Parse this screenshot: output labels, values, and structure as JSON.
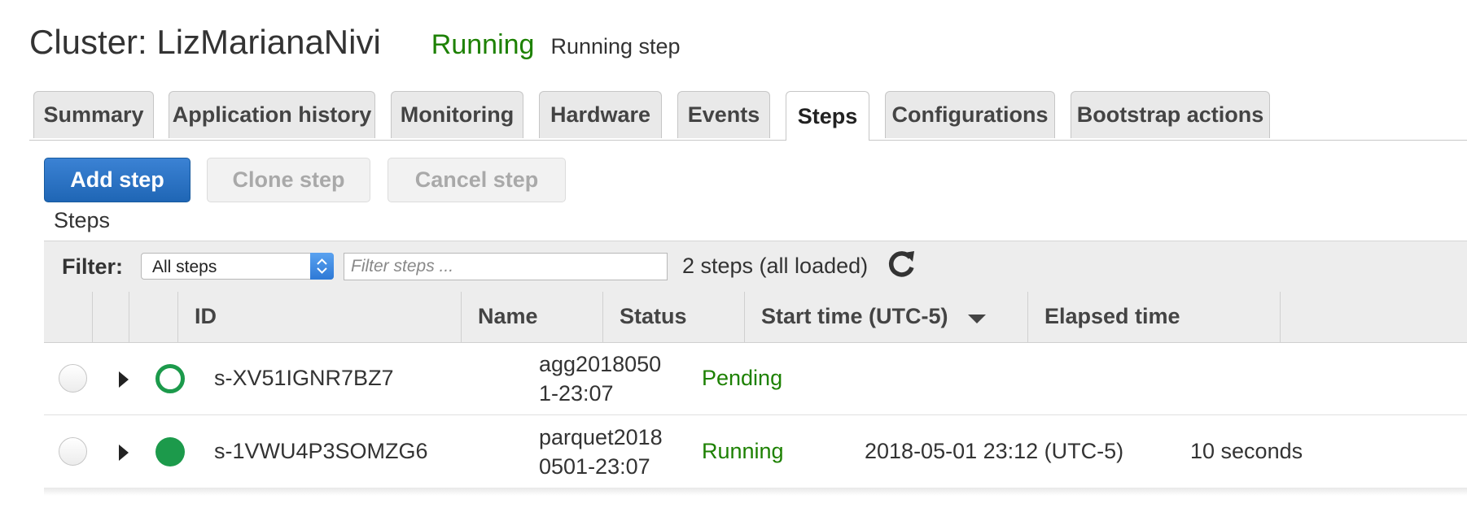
{
  "cluster": {
    "title": "Cluster: LizMarianaNivi",
    "state": "Running",
    "state_detail": "Running step"
  },
  "tabs": [
    {
      "label": "Summary"
    },
    {
      "label": "Application history"
    },
    {
      "label": "Monitoring"
    },
    {
      "label": "Hardware"
    },
    {
      "label": "Events"
    },
    {
      "label": "Steps",
      "active": true
    },
    {
      "label": "Configurations"
    },
    {
      "label": "Bootstrap actions"
    }
  ],
  "toolbar": {
    "add_step": "Add step",
    "clone_step": "Clone step",
    "cancel_step": "Cancel step"
  },
  "section_title": "Steps",
  "filter": {
    "label": "Filter:",
    "select_value": "All steps",
    "input_placeholder": "Filter steps ...",
    "count_text": "2 steps (all loaded)"
  },
  "table": {
    "columns": [
      "ID",
      "Name",
      "Status",
      "Start time (UTC-5)",
      "Elapsed time"
    ],
    "sorted_column": "Start time (UTC-5)",
    "rows": [
      {
        "id": "s-XV51IGNR7BZ7",
        "name_line1": "agg2018050",
        "name_line2": "1-23:07",
        "status": "Pending",
        "start_time": "",
        "elapsed": ""
      },
      {
        "id": "s-1VWU4P3SOMZG6",
        "name_line1": "parquet2018",
        "name_line2": "0501-23:07",
        "status": "Running",
        "start_time": "2018-05-01 23:12 (UTC-5)",
        "elapsed": "10 seconds"
      }
    ]
  },
  "colors": {
    "status_green": "#1d8102",
    "primary_blue": "#1f66b5"
  },
  "icons": {
    "refresh": "refresh-icon",
    "sort": "sort-descending-icon",
    "expand": "expand-triangle-icon",
    "select": "select-stepper-icon"
  }
}
